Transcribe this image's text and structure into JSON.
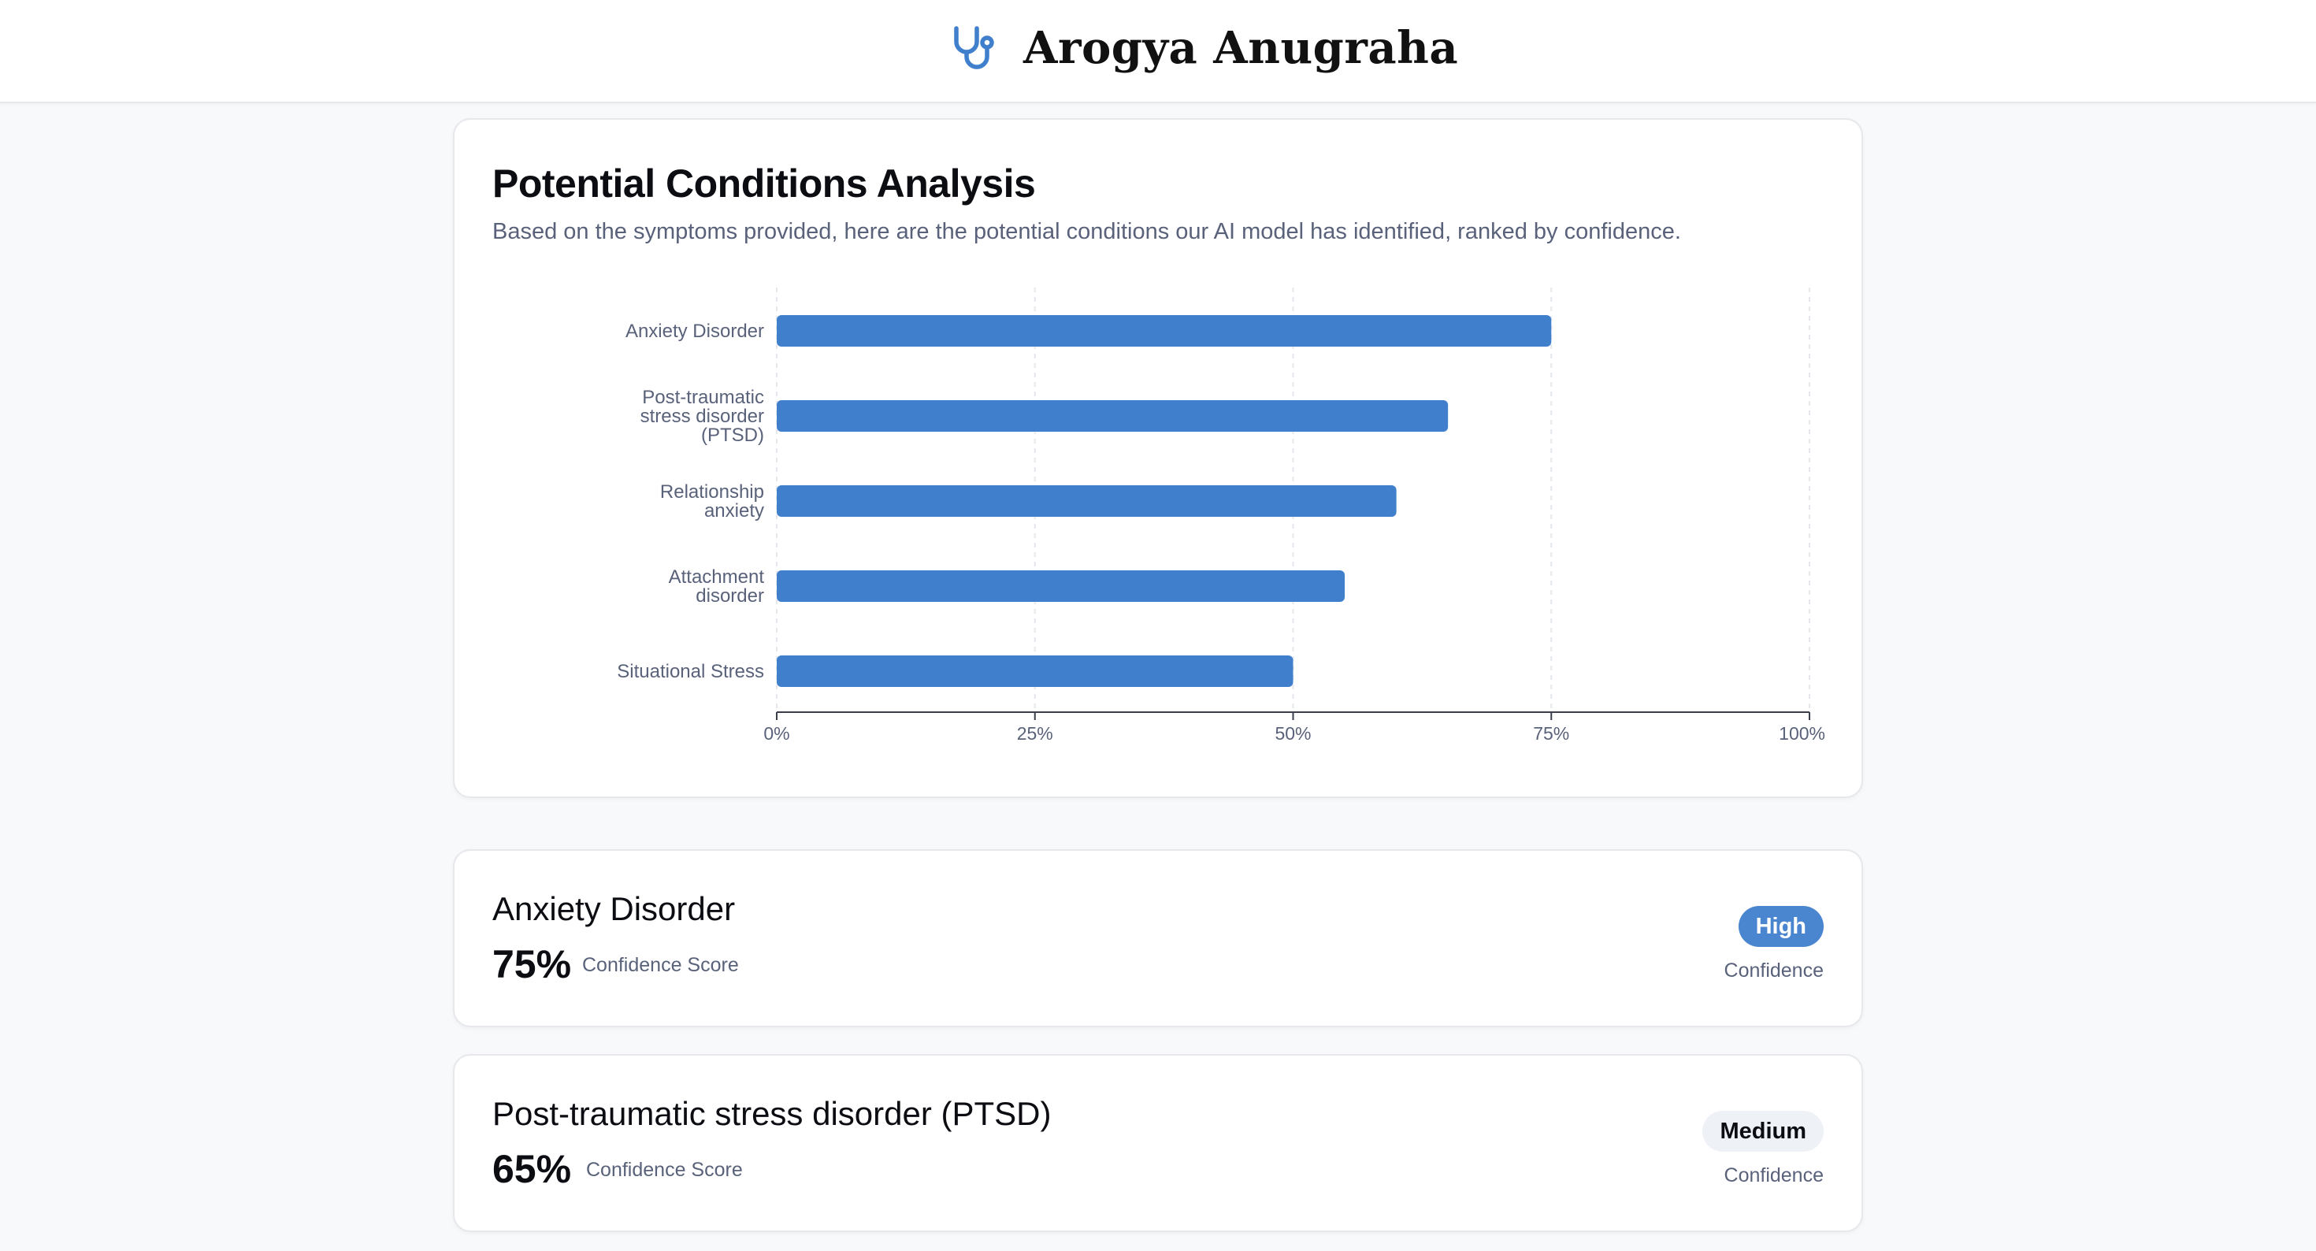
{
  "app": {
    "title": "Arogya Anugraha",
    "logo_icon": "stethoscope-icon"
  },
  "analysis": {
    "title": "Potential Conditions Analysis",
    "subtitle": "Based on the symptoms provided, here are the potential conditions our AI model has identified, ranked by confidence."
  },
  "chart_data": {
    "type": "bar",
    "orientation": "horizontal",
    "categories": [
      [
        "Anxiety Disorder"
      ],
      [
        "Post-traumatic",
        "stress disorder",
        "(PTSD)"
      ],
      [
        "Relationship",
        "anxiety"
      ],
      [
        "Attachment",
        "disorder"
      ],
      [
        "Situational Stress"
      ]
    ],
    "values": [
      75,
      65,
      60,
      55,
      50
    ],
    "xlim": [
      0,
      100
    ],
    "xticks": [
      "0%",
      "25%",
      "50%",
      "75%",
      "100%"
    ],
    "grid": "vertical dashed",
    "bar_color": "#3f7fcb"
  },
  "conditions": [
    {
      "name": "Anxiety Disorder",
      "score": "75%",
      "score_label": "Confidence Score",
      "level": "High",
      "level_label": "Confidence"
    },
    {
      "name": "Post-traumatic stress disorder (PTSD)",
      "score": "65%",
      "score_label": "Confidence Score",
      "level": "Medium",
      "level_label": "Confidence"
    }
  ]
}
